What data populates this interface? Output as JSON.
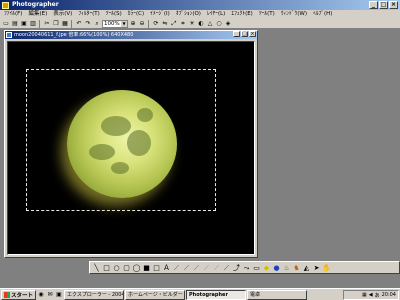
{
  "window": {
    "title": "Photographer",
    "controls": [
      "_",
      "□",
      "×"
    ]
  },
  "menu": [
    "ﾌｧｲﾙ(F)",
    "編集(E)",
    "表示(V)",
    "ﾌｨﾙﾀｰ(T)",
    "ﾂｰﾙ(S)",
    "ｶﾗｰ(C)",
    "ｲﾒｰｼﾞ(I)",
    "ｵﾌﾟｼｮﾝ(O)",
    "ﾚｲﾔｰ(L)",
    "ｴﾌｪｸﾄ(E)",
    "ﾂｰﾙ(T)",
    "ｳｨﾝﾄﾞｳ(W)",
    "ﾍﾙﾌﾟ(H)"
  ],
  "toolbar": {
    "zoom": "100%"
  },
  "document": {
    "title": "moon20040611_f.jpe  倍率:66%(100%) 640X480",
    "controls": [
      "_",
      "□",
      "×"
    ]
  },
  "taskbar": {
    "start_label": "スタート",
    "tasks": [
      {
        "label": "エクスプローラー - 200406"
      },
      {
        "label": "ホームページ・ビルダー - [t"
      },
      {
        "label": "Photographer"
      },
      {
        "label": "電卓"
      }
    ],
    "clock": "20:04"
  },
  "colors": {
    "titlebar": "#0a246a",
    "chrome": "#d4d0c8",
    "workspace": "#808080"
  }
}
